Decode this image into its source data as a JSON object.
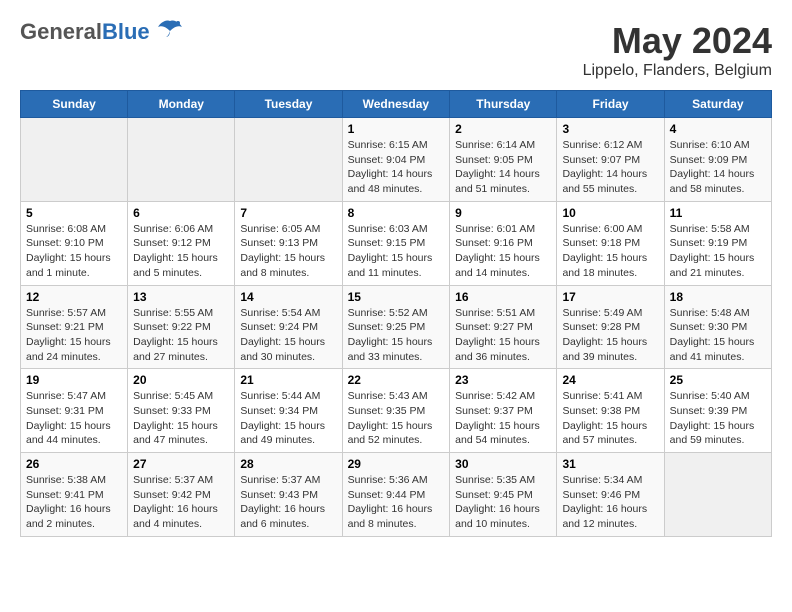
{
  "header": {
    "logo_general": "General",
    "logo_blue": "Blue",
    "title": "May 2024",
    "subtitle": "Lippelo, Flanders, Belgium"
  },
  "calendar": {
    "days_of_week": [
      "Sunday",
      "Monday",
      "Tuesday",
      "Wednesday",
      "Thursday",
      "Friday",
      "Saturday"
    ],
    "weeks": [
      [
        {
          "day": "",
          "info": ""
        },
        {
          "day": "",
          "info": ""
        },
        {
          "day": "",
          "info": ""
        },
        {
          "day": "1",
          "info": "Sunrise: 6:15 AM\nSunset: 9:04 PM\nDaylight: 14 hours\nand 48 minutes."
        },
        {
          "day": "2",
          "info": "Sunrise: 6:14 AM\nSunset: 9:05 PM\nDaylight: 14 hours\nand 51 minutes."
        },
        {
          "day": "3",
          "info": "Sunrise: 6:12 AM\nSunset: 9:07 PM\nDaylight: 14 hours\nand 55 minutes."
        },
        {
          "day": "4",
          "info": "Sunrise: 6:10 AM\nSunset: 9:09 PM\nDaylight: 14 hours\nand 58 minutes."
        }
      ],
      [
        {
          "day": "5",
          "info": "Sunrise: 6:08 AM\nSunset: 9:10 PM\nDaylight: 15 hours\nand 1 minute."
        },
        {
          "day": "6",
          "info": "Sunrise: 6:06 AM\nSunset: 9:12 PM\nDaylight: 15 hours\nand 5 minutes."
        },
        {
          "day": "7",
          "info": "Sunrise: 6:05 AM\nSunset: 9:13 PM\nDaylight: 15 hours\nand 8 minutes."
        },
        {
          "day": "8",
          "info": "Sunrise: 6:03 AM\nSunset: 9:15 PM\nDaylight: 15 hours\nand 11 minutes."
        },
        {
          "day": "9",
          "info": "Sunrise: 6:01 AM\nSunset: 9:16 PM\nDaylight: 15 hours\nand 14 minutes."
        },
        {
          "day": "10",
          "info": "Sunrise: 6:00 AM\nSunset: 9:18 PM\nDaylight: 15 hours\nand 18 minutes."
        },
        {
          "day": "11",
          "info": "Sunrise: 5:58 AM\nSunset: 9:19 PM\nDaylight: 15 hours\nand 21 minutes."
        }
      ],
      [
        {
          "day": "12",
          "info": "Sunrise: 5:57 AM\nSunset: 9:21 PM\nDaylight: 15 hours\nand 24 minutes."
        },
        {
          "day": "13",
          "info": "Sunrise: 5:55 AM\nSunset: 9:22 PM\nDaylight: 15 hours\nand 27 minutes."
        },
        {
          "day": "14",
          "info": "Sunrise: 5:54 AM\nSunset: 9:24 PM\nDaylight: 15 hours\nand 30 minutes."
        },
        {
          "day": "15",
          "info": "Sunrise: 5:52 AM\nSunset: 9:25 PM\nDaylight: 15 hours\nand 33 minutes."
        },
        {
          "day": "16",
          "info": "Sunrise: 5:51 AM\nSunset: 9:27 PM\nDaylight: 15 hours\nand 36 minutes."
        },
        {
          "day": "17",
          "info": "Sunrise: 5:49 AM\nSunset: 9:28 PM\nDaylight: 15 hours\nand 39 minutes."
        },
        {
          "day": "18",
          "info": "Sunrise: 5:48 AM\nSunset: 9:30 PM\nDaylight: 15 hours\nand 41 minutes."
        }
      ],
      [
        {
          "day": "19",
          "info": "Sunrise: 5:47 AM\nSunset: 9:31 PM\nDaylight: 15 hours\nand 44 minutes."
        },
        {
          "day": "20",
          "info": "Sunrise: 5:45 AM\nSunset: 9:33 PM\nDaylight: 15 hours\nand 47 minutes."
        },
        {
          "day": "21",
          "info": "Sunrise: 5:44 AM\nSunset: 9:34 PM\nDaylight: 15 hours\nand 49 minutes."
        },
        {
          "day": "22",
          "info": "Sunrise: 5:43 AM\nSunset: 9:35 PM\nDaylight: 15 hours\nand 52 minutes."
        },
        {
          "day": "23",
          "info": "Sunrise: 5:42 AM\nSunset: 9:37 PM\nDaylight: 15 hours\nand 54 minutes."
        },
        {
          "day": "24",
          "info": "Sunrise: 5:41 AM\nSunset: 9:38 PM\nDaylight: 15 hours\nand 57 minutes."
        },
        {
          "day": "25",
          "info": "Sunrise: 5:40 AM\nSunset: 9:39 PM\nDaylight: 15 hours\nand 59 minutes."
        }
      ],
      [
        {
          "day": "26",
          "info": "Sunrise: 5:38 AM\nSunset: 9:41 PM\nDaylight: 16 hours\nand 2 minutes."
        },
        {
          "day": "27",
          "info": "Sunrise: 5:37 AM\nSunset: 9:42 PM\nDaylight: 16 hours\nand 4 minutes."
        },
        {
          "day": "28",
          "info": "Sunrise: 5:37 AM\nSunset: 9:43 PM\nDaylight: 16 hours\nand 6 minutes."
        },
        {
          "day": "29",
          "info": "Sunrise: 5:36 AM\nSunset: 9:44 PM\nDaylight: 16 hours\nand 8 minutes."
        },
        {
          "day": "30",
          "info": "Sunrise: 5:35 AM\nSunset: 9:45 PM\nDaylight: 16 hours\nand 10 minutes."
        },
        {
          "day": "31",
          "info": "Sunrise: 5:34 AM\nSunset: 9:46 PM\nDaylight: 16 hours\nand 12 minutes."
        },
        {
          "day": "",
          "info": ""
        }
      ]
    ]
  }
}
